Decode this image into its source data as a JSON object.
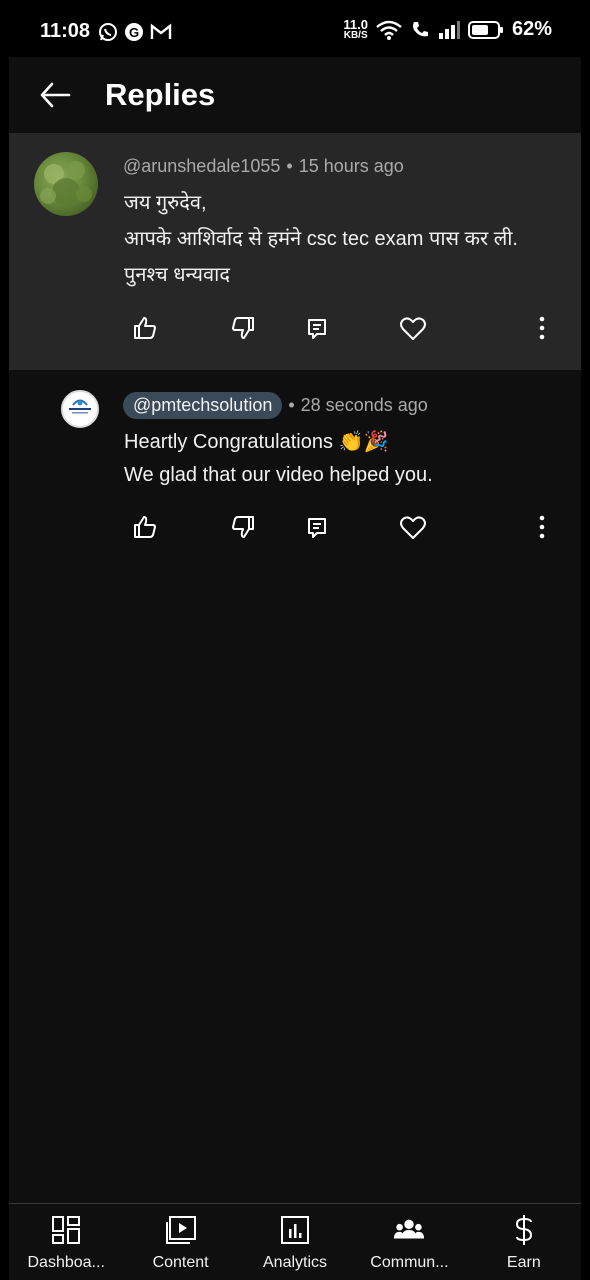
{
  "status_bar": {
    "time": "11:08",
    "net_speed_value": "11.0",
    "net_speed_unit": "KB/S",
    "battery_percent": "62%"
  },
  "header": {
    "title": "Replies"
  },
  "parent_comment": {
    "author": "@arunshedale1055",
    "separator": "•",
    "time_ago": "15 hours ago",
    "text": "जय गुरुदेव,\nआपके आशिर्वाद से हमंने csc tec exam पास कर ली. पुनश्च धन्यवाद"
  },
  "reply_comment": {
    "author": "@pmtechsolution",
    "separator": "•",
    "time_ago": "28 seconds ago",
    "text": "Heartly Congratulations 👏🎉\nWe glad that our video helped you."
  },
  "bottom_nav": {
    "items": [
      {
        "label": "Dashboa...",
        "icon": "dashboard-icon"
      },
      {
        "label": "Content",
        "icon": "content-icon"
      },
      {
        "label": "Analytics",
        "icon": "analytics-icon"
      },
      {
        "label": "Commun...",
        "icon": "community-icon"
      },
      {
        "label": "Earn",
        "icon": "earn-icon"
      }
    ]
  },
  "colors": {
    "background": "#0f0f0f",
    "parent_highlight": "#272727",
    "handle_chip": "#3b4a59",
    "secondary_text": "#aaaaaa"
  }
}
